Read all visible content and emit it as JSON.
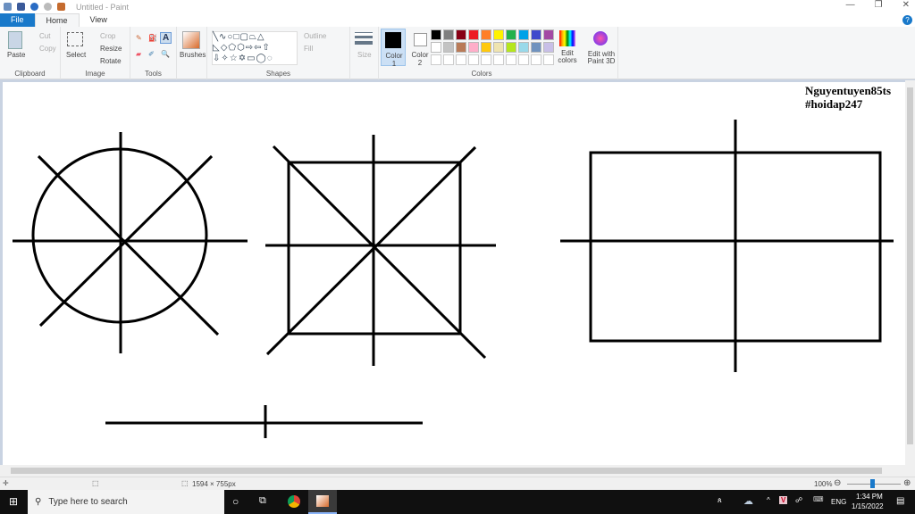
{
  "window": {
    "title": "Untitled - Paint"
  },
  "tabs": [
    {
      "label": "File"
    },
    {
      "label": "Home"
    },
    {
      "label": "View"
    }
  ],
  "ribbon": {
    "clipboard": {
      "label": "Clipboard",
      "paste": "Paste",
      "cut": "Cut",
      "copy": "Copy"
    },
    "image": {
      "label": "Image",
      "select": "Select",
      "crop": "Crop",
      "resize": "Resize",
      "rotate": "Rotate"
    },
    "tools": {
      "label": "Tools"
    },
    "brushes": {
      "label": "Brushes"
    },
    "shapes": {
      "label": "Shapes",
      "outline": "Outline",
      "fill": "Fill"
    },
    "size": {
      "label": "Size"
    },
    "colors": {
      "label": "Colors",
      "color1": "Color 1",
      "color2": "Color 2",
      "edit": "Edit colors",
      "paint3d": "Edit with Paint 3D",
      "palette_row1": [
        "#000000",
        "#7f7f7f",
        "#880015",
        "#ed1c24",
        "#ff7f27",
        "#fff200",
        "#22b14c",
        "#00a2e8",
        "#3f48cc",
        "#a349a4"
      ],
      "palette_row2": [
        "#ffffff",
        "#c3c3c3",
        "#b97a57",
        "#ffaec9",
        "#ffc90e",
        "#efe4b0",
        "#b5e61d",
        "#99d9ea",
        "#7092be",
        "#c8bfe7"
      ]
    }
  },
  "canvas": {
    "signature_line1": "Nguyentuyen85ts",
    "signature_line2": "#hoidap247"
  },
  "status": {
    "dimensions": "1594 × 755px",
    "zoom": "100%"
  },
  "taskbar": {
    "search_placeholder": "Type here to search",
    "lang": "ENG",
    "time": "1:34 PM",
    "date": "1/15/2022"
  }
}
